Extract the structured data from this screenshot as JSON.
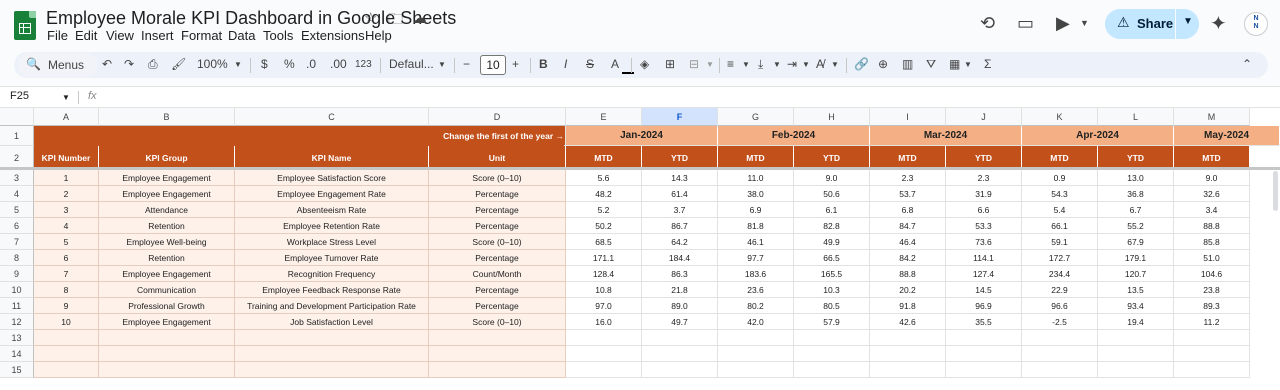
{
  "app": {
    "title": "Employee Morale KPI Dashboard in Google Sheets",
    "menus": [
      "File",
      "Edit",
      "View",
      "Insert",
      "Format",
      "Data",
      "Tools",
      "Extensions",
      "Help"
    ],
    "share_label": "Share",
    "avatar_text": "N\nN"
  },
  "toolbar": {
    "search_label": "Menus",
    "zoom": "100%",
    "currency": "$",
    "percent": "%",
    "dec_decrease": ".0",
    "dec_increase": ".00",
    "number_format": "123",
    "font": "Defaul...",
    "font_size": "10",
    "bold": "B",
    "italic": "I",
    "text_color": "A"
  },
  "formula_bar": {
    "name_box": "F25",
    "fx": "fx",
    "content": ""
  },
  "columns": [
    "A",
    "B",
    "C",
    "D",
    "E",
    "F",
    "G",
    "H",
    "I",
    "J",
    "K",
    "L",
    "M"
  ],
  "selected_column": "F",
  "rows": [
    "1",
    "2",
    "3",
    "4",
    "5",
    "6",
    "7",
    "8",
    "9",
    "10",
    "11",
    "12",
    "13",
    "14",
    "15"
  ],
  "sheet": {
    "row1_note": "Change the first of the year →",
    "months": [
      "Jan-2024",
      "Feb-2024",
      "Mar-2024",
      "Apr-2024",
      "May-2024"
    ],
    "headers": [
      "KPI Number",
      "KPI Group",
      "KPI Name",
      "Unit"
    ],
    "period_headers": [
      "MTD",
      "YTD",
      "MTD",
      "YTD",
      "MTD",
      "YTD",
      "MTD",
      "YTD",
      "MTD"
    ],
    "kpis": [
      {
        "num": "1",
        "group": "Employee Engagement",
        "name": "Employee Satisfaction Score",
        "unit": "Score (0–10)",
        "values": [
          "5.6",
          "14.3",
          "11.0",
          "9.0",
          "2.3",
          "2.3",
          "0.9",
          "13.0",
          "9.0"
        ]
      },
      {
        "num": "2",
        "group": "Employee Engagement",
        "name": "Employee Engagement Rate",
        "unit": "Percentage",
        "values": [
          "48.2",
          "61.4",
          "38.0",
          "50.6",
          "53.7",
          "31.9",
          "54.3",
          "36.8",
          "32.6"
        ]
      },
      {
        "num": "3",
        "group": "Attendance",
        "name": "Absenteeism Rate",
        "unit": "Percentage",
        "values": [
          "5.2",
          "3.7",
          "6.9",
          "6.1",
          "6.8",
          "6.6",
          "5.4",
          "6.7",
          "3.4"
        ]
      },
      {
        "num": "4",
        "group": "Retention",
        "name": "Employee Retention Rate",
        "unit": "Percentage",
        "values": [
          "50.2",
          "86.7",
          "81.8",
          "82.8",
          "84.7",
          "53.3",
          "66.1",
          "55.2",
          "88.8"
        ]
      },
      {
        "num": "5",
        "group": "Employee Well-being",
        "name": "Workplace Stress Level",
        "unit": "Score (0–10)",
        "values": [
          "68.5",
          "64.2",
          "46.1",
          "49.9",
          "46.4",
          "73.6",
          "59.1",
          "67.9",
          "85.8"
        ]
      },
      {
        "num": "6",
        "group": "Retention",
        "name": "Employee Turnover Rate",
        "unit": "Percentage",
        "values": [
          "171.1",
          "184.4",
          "97.7",
          "66.5",
          "84.2",
          "114.1",
          "172.7",
          "179.1",
          "51.0"
        ]
      },
      {
        "num": "7",
        "group": "Employee Engagement",
        "name": "Recognition Frequency",
        "unit": "Count/Month",
        "values": [
          "128.4",
          "86.3",
          "183.6",
          "165.5",
          "88.8",
          "127.4",
          "234.4",
          "120.7",
          "104.6"
        ]
      },
      {
        "num": "8",
        "group": "Communication",
        "name": "Employee Feedback Response Rate",
        "unit": "Percentage",
        "values": [
          "10.8",
          "21.8",
          "23.6",
          "10.3",
          "20.2",
          "14.5",
          "22.9",
          "13.5",
          "23.8"
        ]
      },
      {
        "num": "9",
        "group": "Professional Growth",
        "name": "Training and Development Participation Rate",
        "unit": "Percentage",
        "values": [
          "97.0",
          "89.0",
          "80.2",
          "80.5",
          "91.8",
          "96.9",
          "96.6",
          "93.4",
          "89.3"
        ]
      },
      {
        "num": "10",
        "group": "Employee Engagement",
        "name": "Job Satisfaction Level",
        "unit": "Score (0–10)",
        "values": [
          "16.0",
          "49.7",
          "42.0",
          "57.9",
          "42.6",
          "35.5",
          "-2.5",
          "19.4",
          "11.2"
        ]
      }
    ]
  },
  "colors": {
    "header_dark": "#c2501b",
    "header_light": "#f4b084",
    "kpi_fill": "#fdf1e9",
    "share_bg": "#c2e7ff"
  }
}
